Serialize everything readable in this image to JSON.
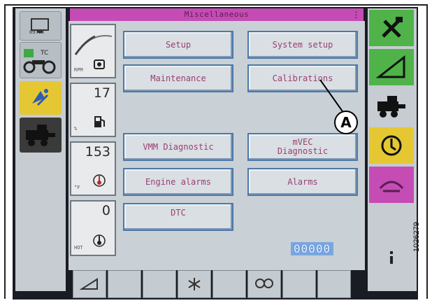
{
  "screen": {
    "title": "Miscellaneous",
    "title_indicator": "⋮",
    "clock": "09:18"
  },
  "gauges": [
    {
      "value": "",
      "tag": "RPM",
      "icon": "engine-icon"
    },
    {
      "value": "17",
      "tag": "%",
      "icon": "fuel-pump-icon"
    },
    {
      "value": "153",
      "tag": "°F",
      "icon": "coolant-temp-icon"
    },
    {
      "value": "0",
      "tag": "HOT",
      "icon": "oil-temp-icon"
    }
  ],
  "menu": {
    "setup": "Setup",
    "system_setup": "System setup",
    "maintenance": "Maintenance",
    "calibrations": "Calibrations",
    "vmm_diagnostic": "VMM Diagnostic",
    "mvec_diagnostic": "mVEC\nDiagnostic",
    "engine_alarms": "Engine alarms",
    "alarms": "Alarms",
    "dtc": "DTC"
  },
  "counter": "00000",
  "callout": "A",
  "figure_id": "1026279",
  "colors": {
    "title_bar": "#c44cb4",
    "button_text": "#9a3f72",
    "button_border": "#4d79a8",
    "rail_green": "#4fb34a",
    "rail_yellow": "#e4c733",
    "rail_magenta": "#c44cb4"
  }
}
